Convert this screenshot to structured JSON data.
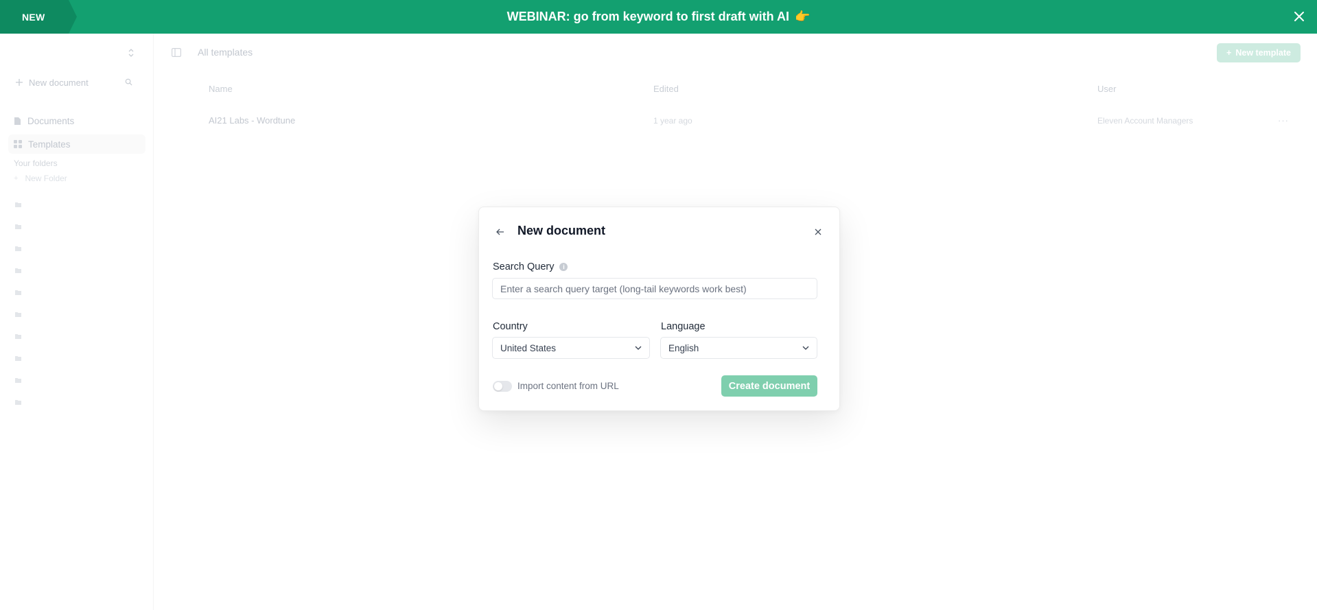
{
  "banner": {
    "badge": "NEW",
    "text": "WEBINAR: go from keyword to first draft with AI",
    "emoji": "👉"
  },
  "sidebar": {
    "new_document": "New document",
    "items": [
      {
        "label": "Documents",
        "icon": "file-icon"
      },
      {
        "label": "Templates",
        "icon": "grid-icon"
      }
    ],
    "folders_label": "Your folders",
    "new_folder": "New Folder"
  },
  "main": {
    "title": "All templates",
    "new_template": "New template",
    "columns": [
      "Name",
      "Edited",
      "User"
    ],
    "rows": [
      {
        "name": "AI21 Labs - Wordtune",
        "edited": "1 year ago",
        "user": "Eleven Account Managers",
        "more": "···"
      }
    ]
  },
  "modal": {
    "title": "New document",
    "search_label": "Search Query",
    "search_placeholder": "Enter a search query target (long-tail keywords work best)",
    "search_value": "",
    "country_label": "Country",
    "country_value": "United States",
    "language_label": "Language",
    "language_value": "English",
    "import_label": "Import content from URL",
    "import_enabled": false,
    "create_button": "Create document"
  },
  "colors": {
    "banner": "#13a070",
    "banner_badge": "#0e8a60",
    "create_button": "#7fcfae",
    "new_template_button": "#cdebe0"
  }
}
